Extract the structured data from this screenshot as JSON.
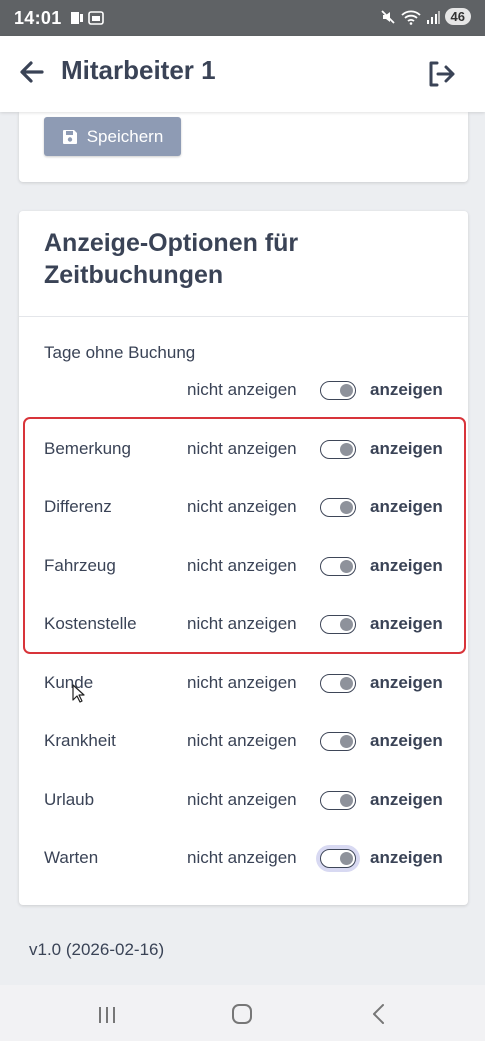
{
  "status_bar": {
    "time": "14:01",
    "battery": "46"
  },
  "header": {
    "title": "Mitarbeiter 1"
  },
  "top_card": {
    "save_label": "Speichern"
  },
  "display_options": {
    "heading": "Anzeige-Optionen für Zeitbuchungen",
    "first_label": "Tage ohne Buchung",
    "off_label": "nicht anzeigen",
    "on_label": "anzeigen",
    "rows": [
      {
        "label": "",
        "on": true
      },
      {
        "label": "Bemerkung",
        "on": true
      },
      {
        "label": "Differenz",
        "on": true
      },
      {
        "label": "Fahrzeug",
        "on": true
      },
      {
        "label": "Kostenstelle",
        "on": true
      },
      {
        "label": "Kunde",
        "on": true
      },
      {
        "label": "Krankheit",
        "on": true
      },
      {
        "label": "Urlaub",
        "on": true
      },
      {
        "label": "Warten",
        "on": true
      }
    ]
  },
  "footer": {
    "version": "v1.0 (2026-02-16)"
  },
  "colors": {
    "accent": "#3a4356",
    "button": "#8e9bb4",
    "highlight": "#d8343a",
    "statusbar": "#5f6265"
  }
}
